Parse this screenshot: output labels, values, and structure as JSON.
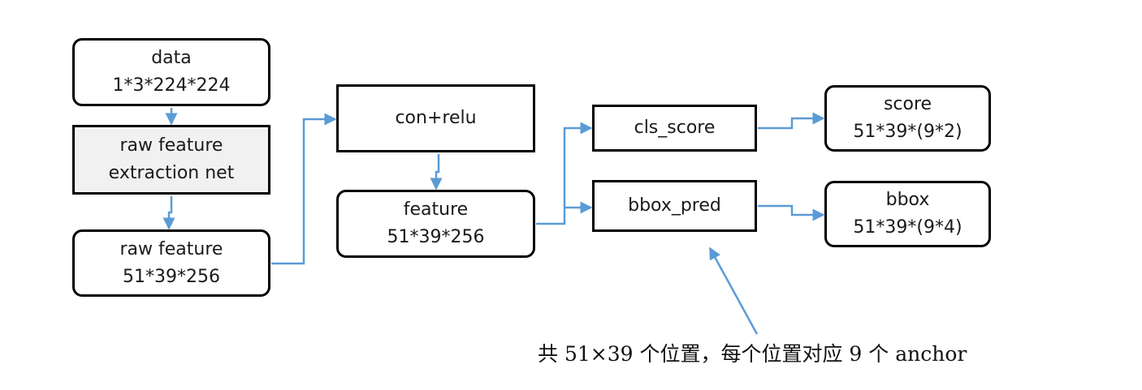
{
  "nodes": {
    "data": {
      "lines": [
        "data",
        "1*3*224*224"
      ]
    },
    "raw_net": {
      "lines": [
        "raw feature",
        "extraction net"
      ]
    },
    "raw_feature": {
      "lines": [
        "raw feature",
        "51*39*256"
      ]
    },
    "conv": {
      "lines": [
        "con+relu"
      ]
    },
    "feature": {
      "lines": [
        "feature",
        "51*39*256"
      ]
    },
    "cls_score": {
      "lines": [
        "cls_score"
      ]
    },
    "bbox_pred": {
      "lines": [
        "bbox_pred"
      ]
    },
    "score": {
      "lines": [
        "score",
        "51*39*(9*2)"
      ]
    },
    "bbox": {
      "lines": [
        "bbox",
        "51*39*(9*4)"
      ]
    }
  },
  "annotation": "共 51×39 个位置，每个位置对应 9 个 anchor",
  "colors": {
    "arrow": "#5b9bd5",
    "border": "#000000",
    "shaded_fill": "#f1f1f1"
  }
}
